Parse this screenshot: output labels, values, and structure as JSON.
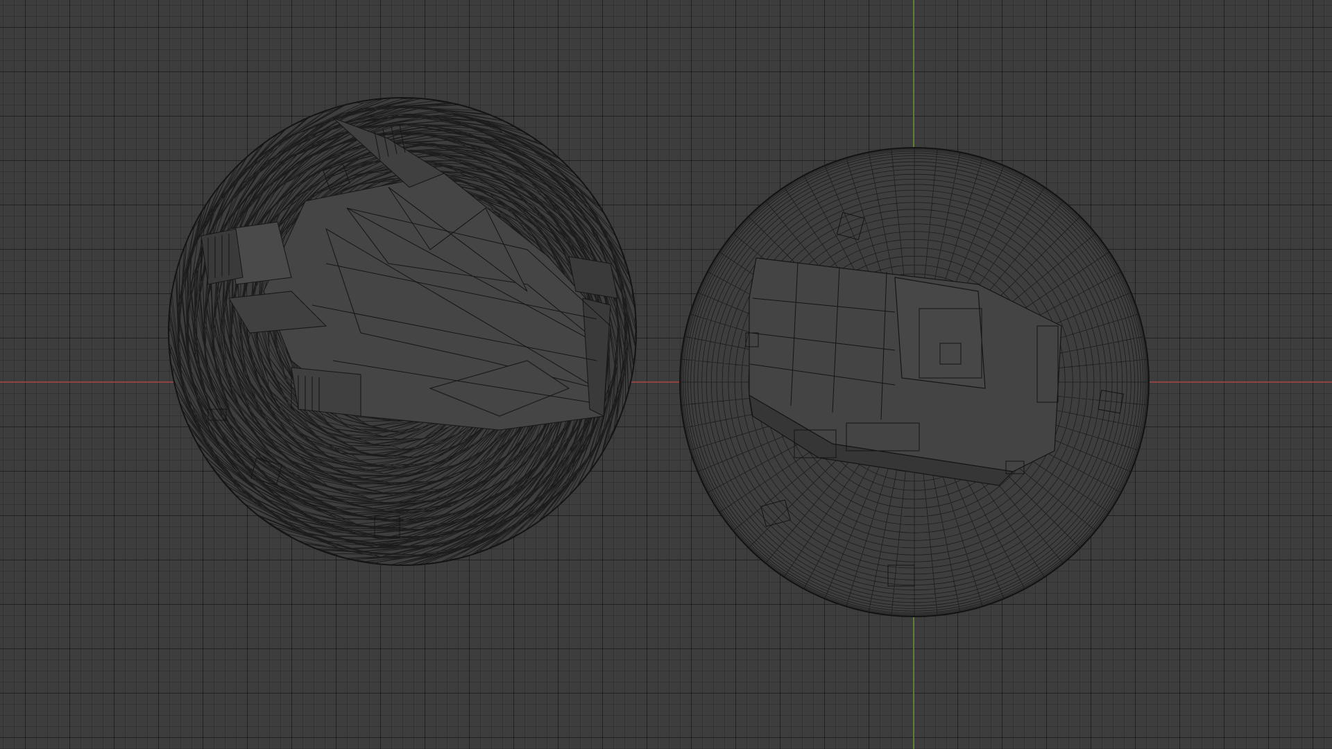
{
  "viewport": {
    "mode": "wireframe",
    "colors": {
      "background": "#3d3d3d",
      "grid_minor": "#363636",
      "grid_major": "#2e2e2e",
      "x_axis": "#b04a4a",
      "y_axis": "#6f9a3a",
      "wire": "#1a1a1a",
      "object_fill": "#3f3f3f"
    }
  },
  "objects": [
    {
      "name": "icosphere-object",
      "topology": "triangulated"
    },
    {
      "name": "uv-sphere-object",
      "topology": "quad"
    }
  ]
}
